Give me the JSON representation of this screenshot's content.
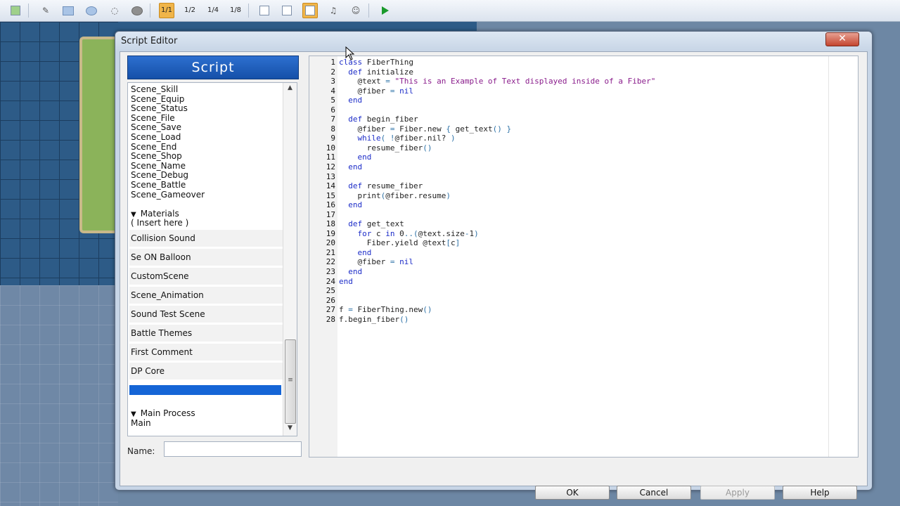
{
  "toolbar": {
    "icons": [
      "map-properties-icon",
      "pencil-icon",
      "rectangle-icon",
      "ellipse-icon",
      "flood-fill-icon",
      "shadow-pen-icon",
      "zoom-1-1-icon",
      "zoom-1-2-icon",
      "zoom-1-4-icon",
      "zoom-1-8-icon",
      "database-icon",
      "resource-manager-icon",
      "script-editor-icon",
      "sound-test-icon",
      "character-generator-icon",
      "playtest-icon"
    ],
    "zoom": [
      "1/1",
      "1/2",
      "1/4",
      "1/8"
    ]
  },
  "dialog": {
    "title": "Script Editor",
    "close_glyph": "✕",
    "header": "Script",
    "scripts_top": [
      "Scene_Skill",
      "Scene_Equip",
      "Scene_Status",
      "Scene_File",
      "Scene_Save",
      "Scene_Load",
      "Scene_End",
      "Scene_Shop",
      "Scene_Name",
      "Scene_Debug",
      "Scene_Battle",
      "Scene_Gameover"
    ],
    "materials_label": "Materials",
    "insert_label": "( Insert here )",
    "scripts_materials": [
      "Collision Sound",
      "Se ON Balloon",
      "CustomScene",
      "Scene_Animation",
      "Sound Test Scene",
      "Battle Themes",
      "First Comment",
      "DP Core"
    ],
    "main_process_label": "Main Process",
    "main_label": "Main",
    "name_label": "Name:",
    "name_value": "",
    "buttons": {
      "ok": "OK",
      "cancel": "Cancel",
      "apply": "Apply",
      "help": "Help"
    }
  },
  "code": [
    {
      "n": "1",
      "t": "<span class=\"k\">class</span> FiberThing"
    },
    {
      "n": "2",
      "t": "  <span class=\"k\">def</span> initialize"
    },
    {
      "n": "3",
      "t": "    @text <span class=\"o\">=</span> <span class=\"s\">\"This is an Example of Text displayed inside of a Fiber\"</span>"
    },
    {
      "n": "4",
      "t": "    @fiber <span class=\"o\">=</span> <span class=\"k\">nil</span>"
    },
    {
      "n": "5",
      "t": "  <span class=\"k\">end</span>"
    },
    {
      "n": "6",
      "t": ""
    },
    {
      "n": "7",
      "t": "  <span class=\"k\">def</span> begin_fiber"
    },
    {
      "n": "8",
      "t": "    @fiber <span class=\"o\">=</span> Fiber.new <span class=\"o\">{</span> get_text<span class=\"o\">()</span> <span class=\"o\">}</span>"
    },
    {
      "n": "9",
      "t": "    <span class=\"k\">while</span><span class=\"o\">(</span> <span class=\"o\">!</span>@fiber.nil? <span class=\"o\">)</span>"
    },
    {
      "n": "10",
      "t": "      resume_fiber<span class=\"o\">()</span>"
    },
    {
      "n": "11",
      "t": "    <span class=\"k\">end</span>"
    },
    {
      "n": "12",
      "t": "  <span class=\"k\">end</span>"
    },
    {
      "n": "13",
      "t": ""
    },
    {
      "n": "14",
      "t": "  <span class=\"k\">def</span> resume_fiber"
    },
    {
      "n": "15",
      "t": "    print<span class=\"o\">(</span>@fiber.resume<span class=\"o\">)</span>"
    },
    {
      "n": "16",
      "t": "  <span class=\"k\">end</span>"
    },
    {
      "n": "17",
      "t": ""
    },
    {
      "n": "18",
      "t": "  <span class=\"k\">def</span> get_text"
    },
    {
      "n": "19",
      "t": "    <span class=\"k\">for</span> c <span class=\"k\">in</span> 0<span class=\"o\">..(</span>@text.size<span class=\"o\">-</span>1<span class=\"o\">)</span>"
    },
    {
      "n": "20",
      "t": "      Fiber.yield @text<span class=\"o\">[</span>c<span class=\"o\">]</span>"
    },
    {
      "n": "21",
      "t": "    <span class=\"k\">end</span>"
    },
    {
      "n": "22",
      "t": "    @fiber <span class=\"o\">=</span> <span class=\"k\">nil</span>"
    },
    {
      "n": "23",
      "t": "  <span class=\"k\">end</span>"
    },
    {
      "n": "24",
      "t": "<span class=\"k\">end</span>"
    },
    {
      "n": "25",
      "t": ""
    },
    {
      "n": "26",
      "t": ""
    },
    {
      "n": "27",
      "t": "f <span class=\"o\">=</span> FiberThing.new<span class=\"o\">()</span>"
    },
    {
      "n": "28",
      "t": "f.begin_fiber<span class=\"o\">()</span>"
    }
  ],
  "colors": {
    "accent": "#1565d6",
    "keyword": "#1d2dc8",
    "string": "#8a1d8c",
    "operator": "#2f73a8"
  }
}
